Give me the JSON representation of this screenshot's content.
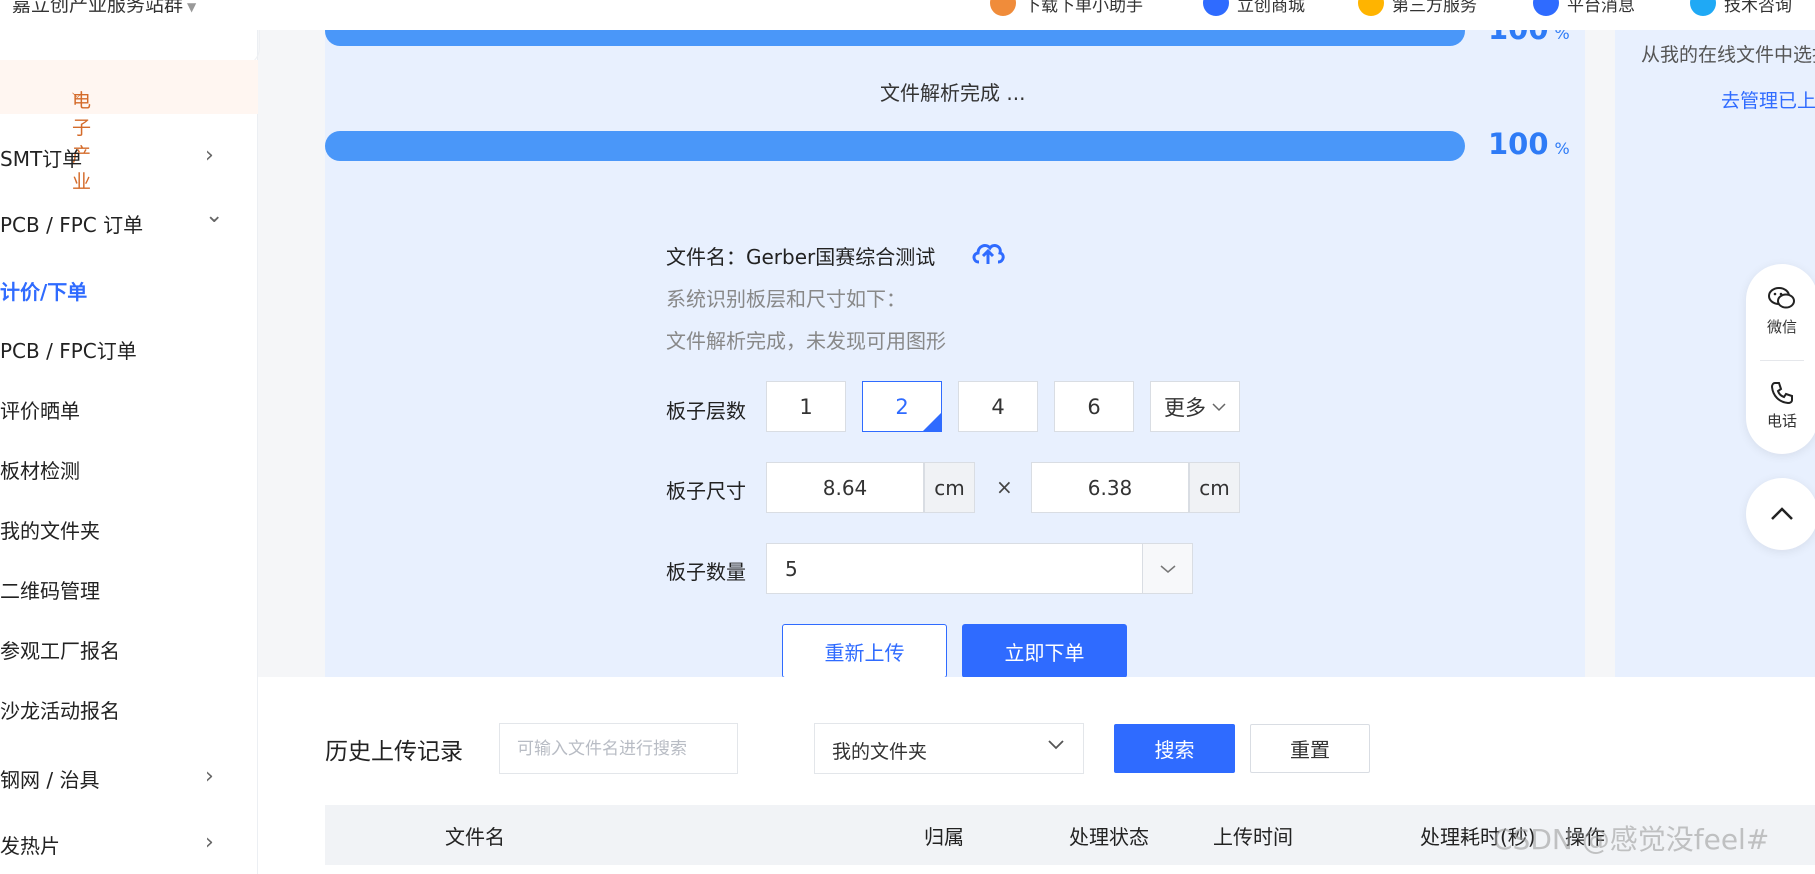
{
  "topnav": {
    "site_name": "嘉立创产业服务站群",
    "links": [
      {
        "label": "下载下单小助手",
        "icon_color": "#f08c3a"
      },
      {
        "label": "立创商城",
        "icon_color": "#2f6bff"
      },
      {
        "label": "第三方服务",
        "icon_color": "#ffb400"
      },
      {
        "label": "平台消息",
        "icon_color": "#2f6bff"
      },
      {
        "label": "技术咨询",
        "icon_color": "#1fa9f5"
      }
    ]
  },
  "sidebar": {
    "category": "电子产业",
    "items": [
      {
        "label": "SMT订单",
        "arrow": "›"
      },
      {
        "label": "PCB / FPC 订单",
        "arrow": "⌄"
      },
      {
        "label": "计价/下单",
        "arrow": ""
      },
      {
        "label": "PCB / FPC订单",
        "arrow": ""
      },
      {
        "label": "评价晒单",
        "arrow": ""
      },
      {
        "label": "板材检测",
        "arrow": ""
      },
      {
        "label": "我的文件夹",
        "arrow": ""
      },
      {
        "label": "二维码管理",
        "arrow": ""
      },
      {
        "label": "参观工厂报名",
        "arrow": ""
      },
      {
        "label": "沙龙活动报名",
        "arrow": ""
      },
      {
        "label": "钢网 / 治具",
        "arrow": "›"
      },
      {
        "label": "发热片",
        "arrow": "›"
      }
    ]
  },
  "upload": {
    "progress_top": {
      "value": "100",
      "unit": "%",
      "fraction": 1.0
    },
    "parse_status": "文件解析完成 ...",
    "progress_main": {
      "value": "100",
      "unit": "%",
      "fraction": 1.0
    },
    "file_label": "文件名：",
    "file_name": "Gerber国赛综合测试",
    "detect_note": "系统识别板层和尺寸如下：",
    "parse_note": "文件解析完成，未发现可用图形",
    "layers": {
      "label": "板子层数",
      "options": [
        "1",
        "2",
        "4",
        "6"
      ],
      "selected": "2",
      "more": "更多"
    },
    "size": {
      "label": "板子尺寸",
      "width": "8.64",
      "height": "6.38",
      "unit": "cm",
      "times": "×"
    },
    "quantity": {
      "label": "板子数量",
      "value": "5"
    },
    "reupload_label": "重新上传",
    "order_label": "立即下单"
  },
  "right_panel": {
    "hint": "从我的在线文件中选择",
    "manage_link": "去管理已上传"
  },
  "float": {
    "wechat_label": "微信",
    "phone_label": "电话",
    "top_arrow": "^"
  },
  "history": {
    "title": "历史上传记录",
    "search_placeholder": "可输入文件名进行搜索",
    "folder_value": "我的文件夹",
    "search_label": "搜索",
    "reset_label": "重置",
    "columns": [
      "文件名",
      "归属",
      "处理状态",
      "上传时间",
      "处理耗时(秒)",
      "操作"
    ]
  },
  "watermark": "CSDN @感觉没feel#",
  "colors": {
    "accent": "#2f6bff",
    "progress": "#4a97f9",
    "panel_bg": "#e8f0fe",
    "category": "#d46b2a"
  }
}
